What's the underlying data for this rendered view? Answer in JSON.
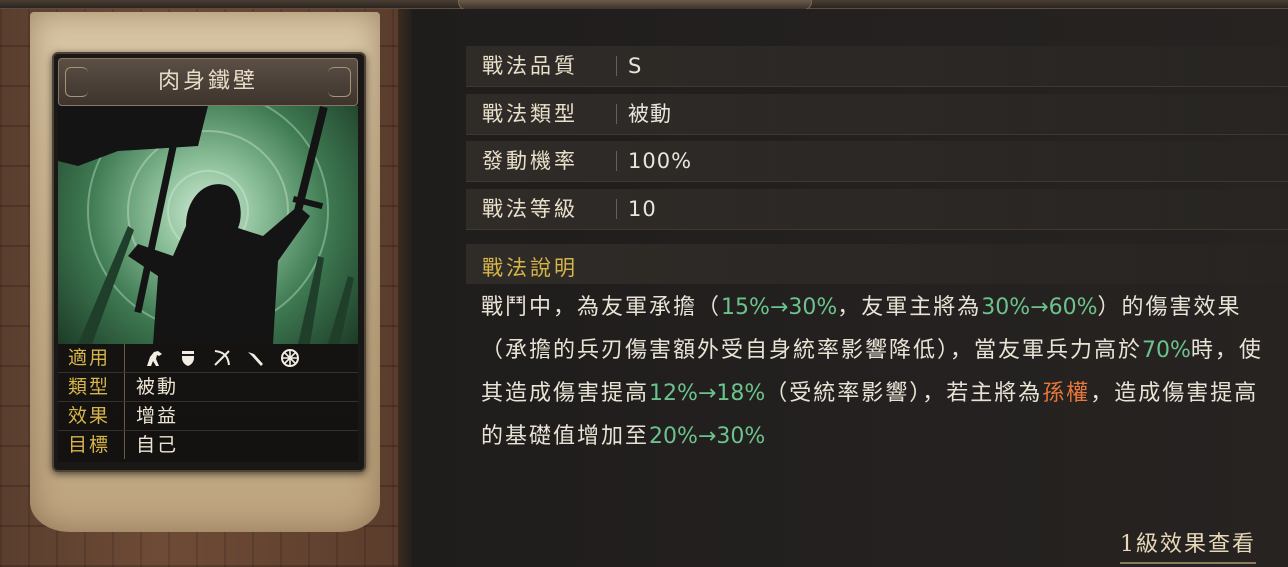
{
  "card": {
    "name": "肉身鐵壁",
    "props": [
      {
        "key": "適用",
        "icons": [
          "cavalry-icon",
          "shield-icon",
          "bow-icon",
          "spear-icon",
          "wheel-icon"
        ]
      },
      {
        "key": "類型",
        "value": "被動"
      },
      {
        "key": "效果",
        "value": "增益"
      },
      {
        "key": "目標",
        "value": "自己"
      }
    ]
  },
  "stats": [
    {
      "label": "戰法品質",
      "value": "S"
    },
    {
      "label": "戰法類型",
      "value": "被動"
    },
    {
      "label": "發動機率",
      "value": "100%"
    },
    {
      "label": "戰法等級",
      "value": "10"
    }
  ],
  "description": {
    "title": "戰法說明",
    "segments": [
      {
        "text": "戰鬥中，為友軍承擔（"
      },
      {
        "text": "15%→30%",
        "color": "green"
      },
      {
        "text": "，友軍主將為"
      },
      {
        "text": "30%→60%",
        "color": "green"
      },
      {
        "text": "）的傷害效果（承擔的兵刃傷害額外受自身統率影響降低），當友軍兵力高於"
      },
      {
        "text": "70%",
        "color": "green"
      },
      {
        "text": "時，使其造成傷害提高"
      },
      {
        "text": "12%→18%",
        "color": "green"
      },
      {
        "text": "（受統率影響），若主將為"
      },
      {
        "text": "孫權",
        "color": "orange"
      },
      {
        "text": "，造成傷害提高的基礎值增加至"
      },
      {
        "text": "20%→30%",
        "color": "green"
      }
    ]
  },
  "level_link": "1級效果查看",
  "colors": {
    "highlight": "#6cc28c",
    "name_highlight": "#e9783a",
    "key_gold": "#d6b54a"
  }
}
